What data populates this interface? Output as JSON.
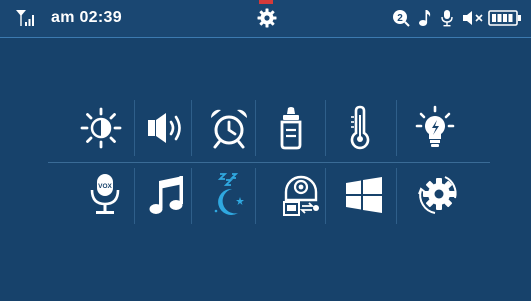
{
  "status_bar": {
    "time": "am 02:39",
    "icons": [
      "signal-icon",
      "settings-gear-icon",
      "notification-2-icon",
      "music-note-icon",
      "microphone-icon",
      "speaker-muted-icon",
      "battery-full-icon"
    ],
    "notification_count": "2",
    "accent_color": "#d43a3a"
  },
  "menu": {
    "row1": [
      "brightness-icon",
      "volume-icon",
      "alarm-clock-icon",
      "feeding-bottle-icon",
      "thermometer-icon",
      "night-light-icon"
    ],
    "row2": [
      "vox-microphone-icon",
      "lullaby-music-icon",
      "sleep-mode-icon",
      "camera-pairing-icon",
      "windows-icon",
      "system-settings-icon"
    ],
    "active_item": "sleep-mode-icon",
    "active_color": "#2fa8e0"
  },
  "labels": {
    "vox": "VOX"
  }
}
